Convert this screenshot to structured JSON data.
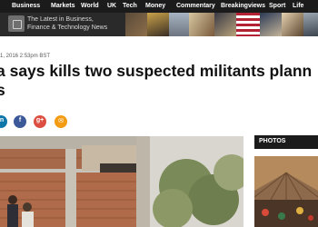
{
  "topnav": {
    "items": [
      "Business",
      "Markets",
      "World",
      "UK",
      "Tech",
      "Money",
      "Commentary",
      "Breakingviews",
      "Sport",
      "Life"
    ]
  },
  "promo": {
    "line1": "The Latest in Business,",
    "line2": "Finance & Technology News"
  },
  "article": {
    "date": "1, 2016 2:53pm BST",
    "headline_line1": "a says kills two suspected militants plann",
    "headline_line2": "s"
  },
  "share": {
    "buttons": [
      {
        "label": "in",
        "color": "#0e76a8"
      },
      {
        "label": "f",
        "color": "#3b5998"
      },
      {
        "label": "g+",
        "color": "#dc4e41"
      },
      {
        "label": "✉",
        "color": "#f39c12"
      }
    ]
  },
  "sidebar": {
    "photos_title": "PHOTOS"
  },
  "colors": {
    "nav_bg": "#1b1b1b",
    "promo_bg": "#2a2a2a"
  }
}
